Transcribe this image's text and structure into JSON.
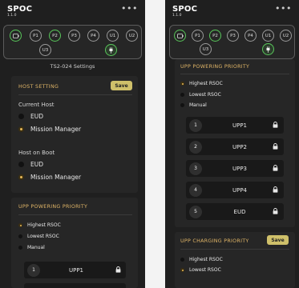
{
  "app": {
    "name": "SPOC",
    "version": "1.1.0",
    "menu_icon": "ellipsis-icon"
  },
  "ports": {
    "left": [
      {
        "label": "",
        "state": "active",
        "icon": "battery-icon"
      },
      {
        "label": "P1",
        "state": "idle"
      },
      {
        "label": "P2",
        "state": "active"
      },
      {
        "label": "P3",
        "state": "idle"
      },
      {
        "label": "P4",
        "state": "idle"
      },
      {
        "label": "U1",
        "state": "idle"
      },
      {
        "label": "U2",
        "state": "idle"
      },
      {
        "label": "U3",
        "state": "idle"
      },
      {
        "label": "",
        "state": "plug",
        "icon": "plug-icon"
      }
    ],
    "right": [
      {
        "label": "",
        "state": "active",
        "icon": "battery-icon"
      },
      {
        "label": "P1",
        "state": "idle"
      },
      {
        "label": "P2",
        "state": "active"
      },
      {
        "label": "P3",
        "state": "idle"
      },
      {
        "label": "P4",
        "state": "idle"
      },
      {
        "label": "U1",
        "state": "idle"
      },
      {
        "label": "U2",
        "state": "idle"
      },
      {
        "label": "U3",
        "state": "idle"
      },
      {
        "label": "",
        "state": "plug",
        "icon": "plug-icon"
      }
    ]
  },
  "settings_title": "TS2-024 Settings",
  "host_setting": {
    "title": "HOST SETTING",
    "save_label": "Save",
    "current_host_label": "Current Host",
    "current_host_options": [
      {
        "label": "EUD",
        "selected": false
      },
      {
        "label": "Mission Manager",
        "selected": true
      }
    ],
    "host_on_boot_label": "Host on Boot",
    "host_on_boot_options": [
      {
        "label": "EUD",
        "selected": false
      },
      {
        "label": "Mission Manager",
        "selected": true
      }
    ]
  },
  "upp_powering_priority": {
    "title": "UPP POWERING PRIORITY",
    "options": [
      {
        "label": "Highest RSOC",
        "selected": true
      },
      {
        "label": "Lowest RSOC",
        "selected": false
      },
      {
        "label": "Manual",
        "selected": false
      }
    ],
    "rows": [
      {
        "number": "1",
        "name": "UPP1",
        "icon": "lock-icon"
      },
      {
        "number": "2",
        "name": "UPP2",
        "icon": "lock-icon"
      },
      {
        "number": "3",
        "name": "UPP3",
        "icon": "lock-icon"
      },
      {
        "number": "4",
        "name": "UPP4",
        "icon": "lock-icon"
      },
      {
        "number": "5",
        "name": "EUD",
        "icon": "lock-icon"
      }
    ]
  },
  "upp_charging_priority": {
    "title": "UPP CHARGING PRIORITY",
    "save_label": "Save",
    "options": [
      {
        "label": "Highest RSOC",
        "selected": false
      },
      {
        "label": "Lowest RSOC",
        "selected": true
      }
    ]
  },
  "colors": {
    "accent": "#e0b567",
    "save": "#cfc06a",
    "port_active": "#58c65a",
    "background": "#1f1f1f"
  }
}
